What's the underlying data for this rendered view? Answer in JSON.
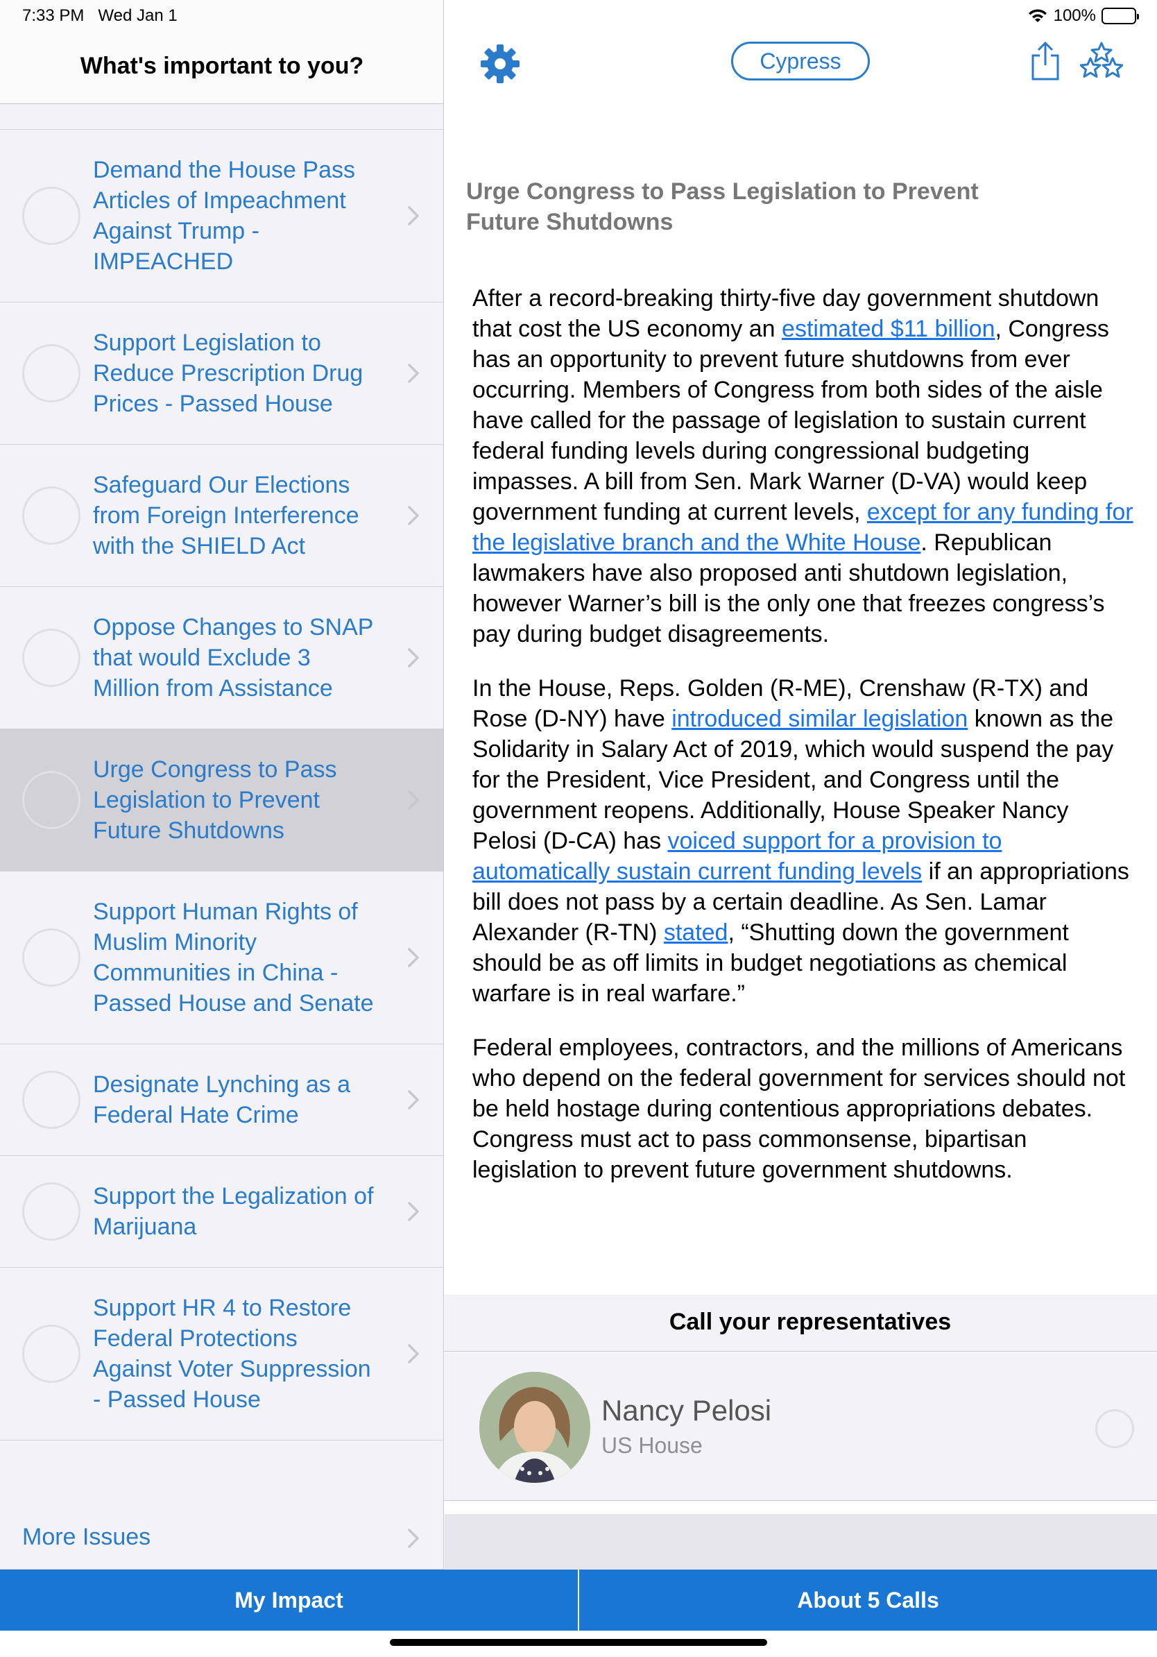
{
  "status": {
    "time": "7:33 PM",
    "date": "Wed Jan 1",
    "battery": "100%"
  },
  "sidebar": {
    "title": "What's important to you?",
    "issues": [
      {
        "label": "Demand the House Pass Articles of Impeachment Against Trump - IMPEACHED",
        "selected": false
      },
      {
        "label": "Support Legislation to Reduce Prescription Drug Prices - Passed House",
        "selected": false
      },
      {
        "label": "Safeguard Our Elections from Foreign Interference with the SHIELD Act",
        "selected": false
      },
      {
        "label": "Oppose Changes to SNAP that would Exclude 3 Million from Assistance",
        "selected": false
      },
      {
        "label": "Urge Congress to Pass Legislation to Prevent Future Shutdowns",
        "selected": true
      },
      {
        "label": "Support Human Rights of Muslim Minority Communities in China - Passed House and Senate",
        "selected": false
      },
      {
        "label": "Designate Lynching as a Federal Hate Crime",
        "selected": false
      },
      {
        "label": "Support the Legalization of Marijuana",
        "selected": false
      },
      {
        "label": "Support HR 4 to Restore Federal Protections Against Voter Suppression - Passed House",
        "selected": false
      }
    ],
    "more_issues": "More Issues"
  },
  "toolbar": {
    "location": "Cypress",
    "icons": [
      "gear-icon",
      "share-icon",
      "stars-icon"
    ]
  },
  "issue": {
    "title": "Urge Congress to Pass Legislation to Prevent Future Shutdowns",
    "p1": {
      "t1": "After a record-breaking thirty-five day government shutdown that cost the US economy an ",
      "l1": "estimated $11 billion",
      "t2": ", Congress has an opportunity to prevent future shutdowns from ever occurring. Members of Congress from both sides of the aisle have called for the passage of legislation to sustain current federal funding levels during congressional budgeting impasses. A bill from Sen. Mark Warner (D-VA) would keep government funding at current levels, ",
      "l2": "except for any funding for the legislative branch and the White House",
      "t3": ". Republican lawmakers have also proposed anti shutdown legislation, however Warner’s bill is the only one that freezes congress’s pay during budget disagreements."
    },
    "p2": {
      "t1": "In the House, Reps. Golden (R-ME), Crenshaw (R-TX) and Rose (D-NY) have ",
      "l1": "introduced similar legislation",
      "t2": " known as the Solidarity in Salary Act of 2019, which would suspend the pay for the President, Vice President, and Congress until the government reopens. Additionally, House Speaker Nancy Pelosi (D-CA) has ",
      "l2": "voiced support for a provision to automatically sustain current funding levels",
      "t3": " if an appropriations bill does not pass by a certain deadline. As Sen. Lamar Alexander (R-TN) ",
      "l3": "stated",
      "t4": ", “Shutting down the government should be as off limits in budget negotiations as chemical warfare is in real warfare.”"
    },
    "p3": "Federal employees, contractors, and the millions of Americans who depend on the federal government for services should not be held hostage during contentious appropriations debates. Congress must act to pass commonsense, bipartisan legislation to prevent future government shutdowns."
  },
  "call": {
    "header": "Call your representatives",
    "reps": [
      {
        "name": "Nancy Pelosi",
        "role": "US House"
      }
    ]
  },
  "tabs": {
    "my_impact": "My Impact",
    "about": "About 5 Calls"
  },
  "colors": {
    "accent": "#2a7bc9",
    "link": "#1a73e8",
    "tabbar": "#1976d2",
    "selected_row": "#d1d1d6"
  }
}
